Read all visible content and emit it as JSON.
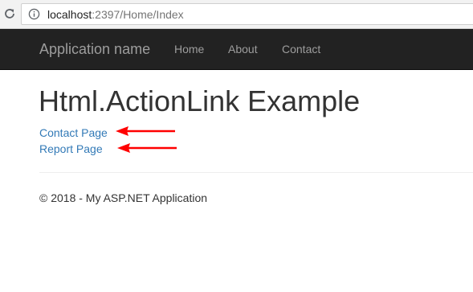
{
  "browser": {
    "url_host": "localhost",
    "url_path": ":2397/Home/Index",
    "reload_icon": "reload-icon",
    "info_icon": "info-icon"
  },
  "navbar": {
    "brand": "Application name",
    "links": [
      "Home",
      "About",
      "Contact"
    ]
  },
  "main": {
    "heading": "Html.ActionLink Example",
    "links": [
      "Contact Page",
      "Report Page"
    ],
    "annotation_color": "#ff0000"
  },
  "footer": {
    "text": "© 2018 - My ASP.NET Application"
  },
  "colors": {
    "navbar_bg": "#222222",
    "nav_text": "#9d9d9d",
    "link": "#337ab7",
    "text": "#333333"
  }
}
